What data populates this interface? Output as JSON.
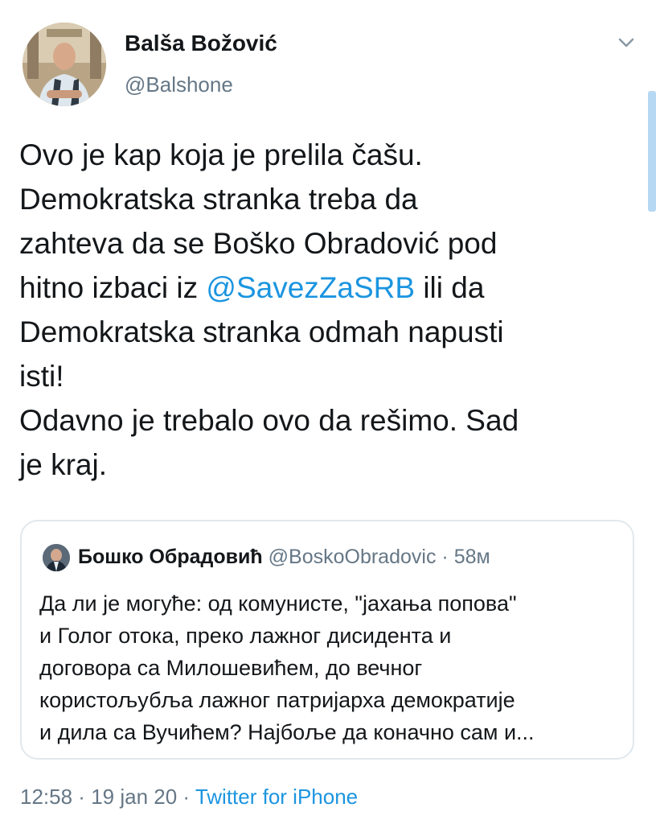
{
  "author": {
    "name": "Balša Božović",
    "handle": "@Balshone"
  },
  "tweet": {
    "lines": [
      {
        "text": "Ovo je kap koja je prelila čašu."
      },
      {
        "text": "Demokratska stranka treba da"
      },
      {
        "text": "zahteva da se Boško Obradović pod"
      },
      {
        "before": "hitno izbaci iz ",
        "mention": "@SavezZaSRB",
        "after": " ili da"
      },
      {
        "text": "Demokratska stranka odmah napusti"
      },
      {
        "text": "isti!"
      },
      {
        "text": "Odavno je trebalo ovo da rešimo. Sad"
      },
      {
        "text": "je kraj."
      }
    ]
  },
  "quoted_tweet": {
    "name": "Бошко Обрадовић",
    "handle": "@BoskoObradovic",
    "separator": "·",
    "time": "58м",
    "lines": [
      "Да ли је могуће: од комунисте, \"јахања попова\"",
      "и Голог отока, преко лажног дисидента и",
      "договора са Милошевићем, до вечног",
      "користољубља лажног патријарха демократије",
      "и дила са Вучићем? Најбоље да коначно сам и..."
    ]
  },
  "meta": {
    "time": "12:58",
    "sep1": " · ",
    "date": "19 jan 20",
    "sep2": " · ",
    "source": "Twitter for iPhone"
  },
  "colors": {
    "link": "#1b95e0",
    "secondary": "#657786",
    "border": "#e1e8ed"
  },
  "icons": {
    "menu": "chevron-down-icon"
  }
}
